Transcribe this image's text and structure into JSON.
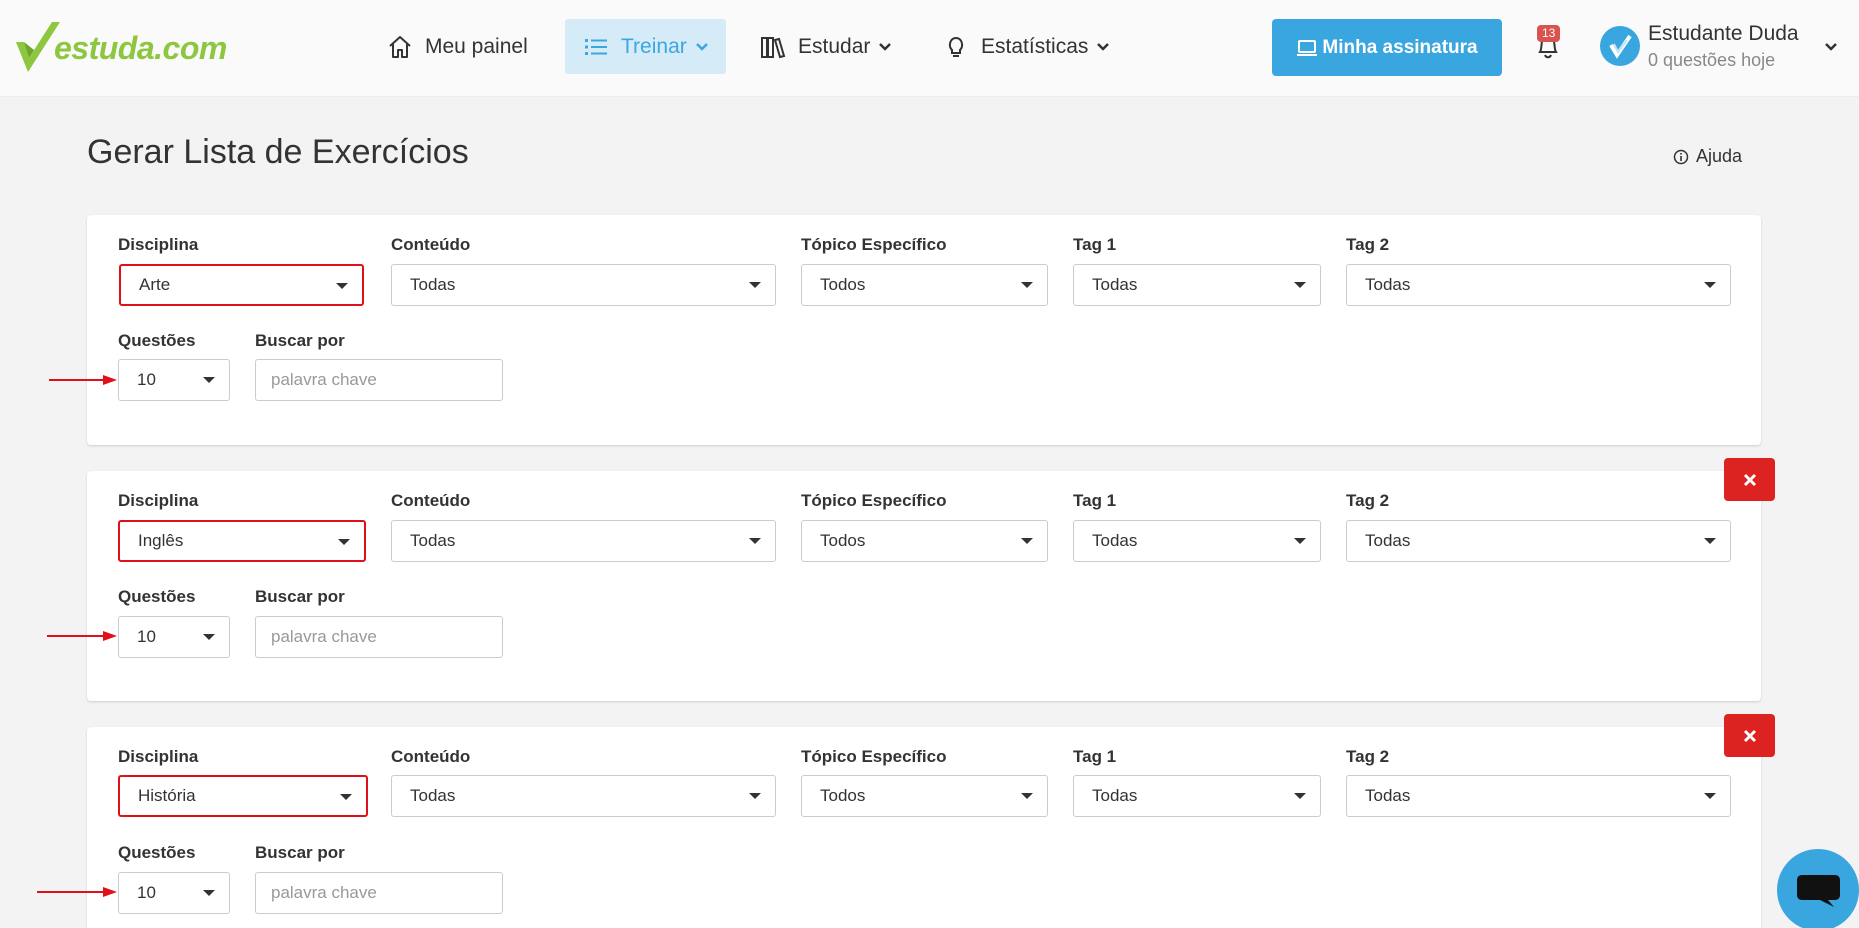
{
  "brand": {
    "logo_text": "estuda.com"
  },
  "nav": {
    "painel": "Meu painel",
    "treinar": "Treinar",
    "estudar": "Estudar",
    "estatisticas": "Estatísticas"
  },
  "header": {
    "subscription_button": "Minha assinatura",
    "notifications_count": "13",
    "user_name": "Estudante Duda",
    "user_sub": "0 questões hoje"
  },
  "page": {
    "title": "Gerar Lista de Exercícios",
    "help": "Ajuda"
  },
  "labels": {
    "disciplina": "Disciplina",
    "conteudo": "Conteúdo",
    "topico": "Tópico Específico",
    "tag1": "Tag 1",
    "tag2": "Tag 2",
    "questoes": "Questões",
    "buscar": "Buscar por"
  },
  "search_placeholder": "palavra chave",
  "cards": [
    {
      "disciplina": "Arte",
      "conteudo": "Todas",
      "topico": "Todos",
      "tag1": "Todas",
      "tag2": "Todas",
      "questoes": "10"
    },
    {
      "disciplina": "Inglês",
      "conteudo": "Todas",
      "topico": "Todos",
      "tag1": "Todas",
      "tag2": "Todas",
      "questoes": "10"
    },
    {
      "disciplina": "História",
      "conteudo": "Todas",
      "topico": "Todos",
      "tag1": "Todas",
      "tag2": "Todas",
      "questoes": "10"
    }
  ],
  "colors": {
    "accent": "#3aa6e0",
    "brand_green": "#8dc63f",
    "highlight_red": "#e0101a",
    "delete_red": "#dd2222"
  }
}
